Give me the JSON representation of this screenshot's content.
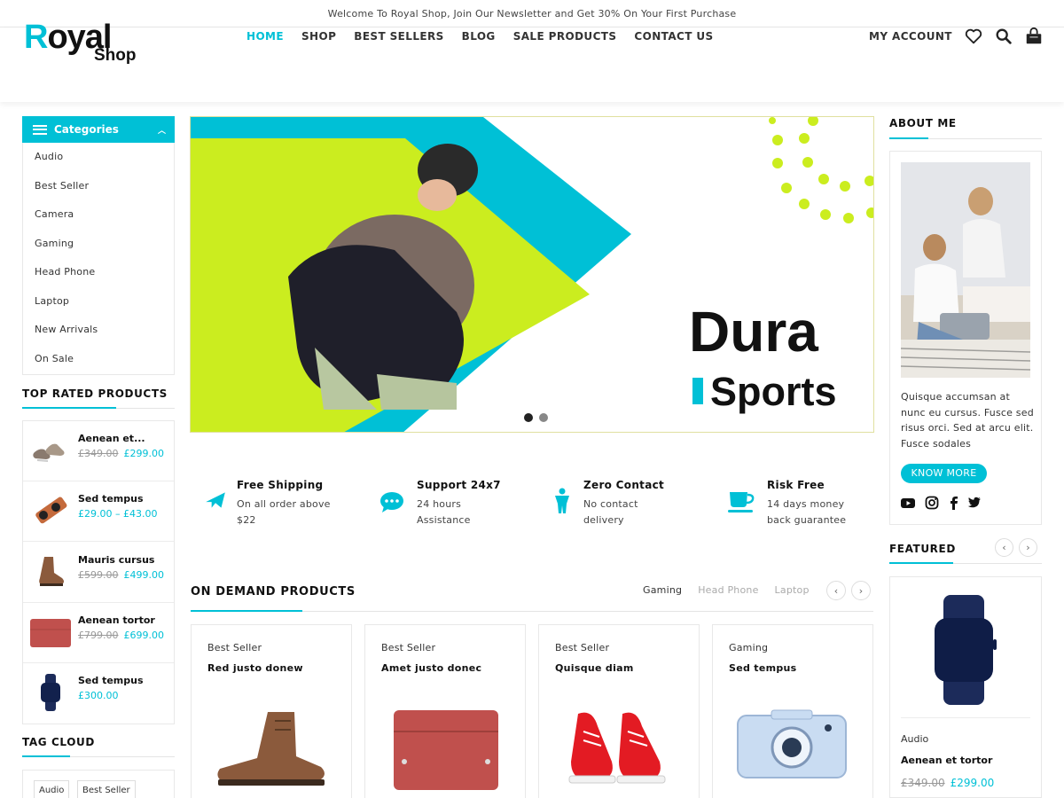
{
  "topbar": {
    "text": "Welcome To Royal Shop, Join Our Newsletter and Get 30% On Your First Purchase"
  },
  "logo": {
    "main_first": "R",
    "main_rest": "oyal",
    "sub": "Shop"
  },
  "nav": {
    "items": [
      "HOME",
      "SHOP",
      "BEST SELLERS",
      "BLOG",
      "SALE PRODUCTS",
      "CONTACT US"
    ],
    "active": "HOME"
  },
  "header": {
    "account": "MY ACCOUNT",
    "icons": [
      "heart-icon",
      "search-icon",
      "cart-icon"
    ]
  },
  "categories": {
    "title": "Categories",
    "items": [
      "Audio",
      "Best Seller",
      "Camera",
      "Gaming",
      "Head Phone",
      "Laptop",
      "New Arrivals",
      "On Sale"
    ]
  },
  "top_rated": {
    "title": "TOP RATED PRODUCTS",
    "items": [
      {
        "name": "Aenean et...",
        "old": "£349.00",
        "price": "£299.00"
      },
      {
        "name": "Sed tempus",
        "old": "",
        "price": "£29.00 – £43.00"
      },
      {
        "name": "Mauris cursus",
        "old": "£599.00",
        "price": "£499.00"
      },
      {
        "name": "Aenean tortor",
        "old": "£799.00",
        "price": "£699.00"
      },
      {
        "name": "Sed tempus",
        "old": "",
        "price": "£300.00"
      }
    ]
  },
  "tag_cloud": {
    "title": "TAG CLOUD",
    "tags": [
      "Audio",
      "Best Seller"
    ]
  },
  "hero": {
    "line1": "Dura",
    "line2": "Sports",
    "slides": 2,
    "active_slide": 1
  },
  "features": [
    {
      "icon": "plane-icon",
      "title": "Free Shipping",
      "line1": "On all order above",
      "line2": "$22"
    },
    {
      "icon": "chat-icon",
      "title": "Support 24x7",
      "line1": "24 hours",
      "line2": "Assistance"
    },
    {
      "icon": "person-icon",
      "title": "Zero Contact",
      "line1": "No contact",
      "line2": "delivery"
    },
    {
      "icon": "cup-icon",
      "title": "Risk Free",
      "line1": "14 days money",
      "line2": "back guarantee"
    }
  ],
  "on_demand": {
    "title": "ON DEMAND PRODUCTS",
    "tabs": [
      "Gaming",
      "Head Phone",
      "Laptop"
    ],
    "active_tab": "Gaming",
    "products": [
      {
        "category": "Best Seller",
        "name": "Red justo donew"
      },
      {
        "category": "Best Seller",
        "name": "Amet justo donec"
      },
      {
        "category": "Best Seller",
        "name": "Quisque diam"
      },
      {
        "category": "Gaming",
        "name": "Sed tempus"
      }
    ]
  },
  "about": {
    "title": "ABOUT ME",
    "text": "Quisque accumsan at nunc eu cursus. Fusce sed risus orci. Sed at arcu elit. Fusce sodales",
    "button": "KNOW MORE",
    "social": [
      "youtube-icon",
      "instagram-icon",
      "facebook-icon",
      "twitter-icon"
    ]
  },
  "featured": {
    "title": "FEATURED",
    "category": "Audio",
    "name": "Aenean et tortor",
    "old": "£349.00",
    "price": "£299.00"
  },
  "colors": {
    "accent": "#00c0d6",
    "lime": "#cbed1f"
  }
}
